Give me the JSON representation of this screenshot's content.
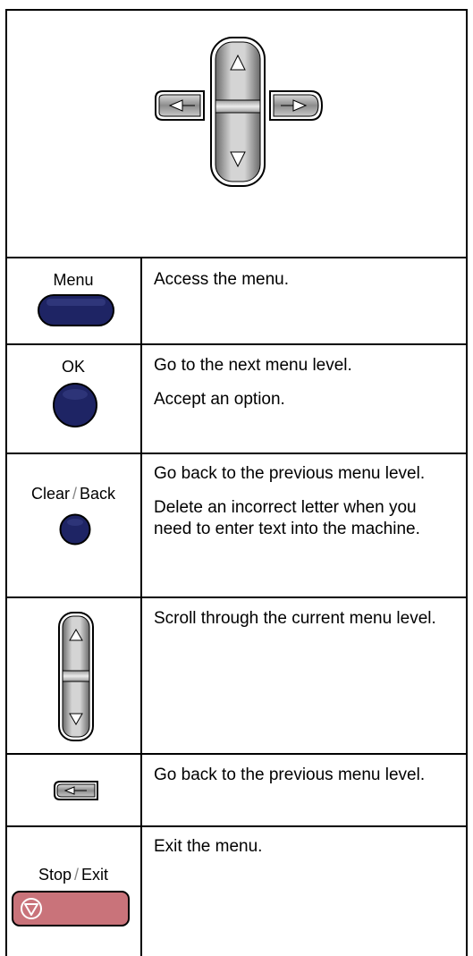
{
  "rows": [
    {
      "button_label": "Menu",
      "description": [
        "Access the menu."
      ]
    },
    {
      "button_label": "OK",
      "description": [
        "Go to the next menu level.",
        "Accept an option."
      ]
    },
    {
      "button_label_left": "Clear",
      "button_label_sep": "/",
      "button_label_right": "Back",
      "description": [
        "Go back to the previous menu level.",
        "Delete an incorrect letter when you need to enter text into the machine."
      ]
    },
    {
      "button_label": "",
      "description": [
        "Scroll through the current menu level."
      ]
    },
    {
      "button_label": "",
      "description": [
        "Go back to the previous menu level."
      ]
    },
    {
      "button_label_left": "Stop",
      "button_label_sep": "/",
      "button_label_right": "Exit",
      "description": [
        "Exit the menu."
      ]
    }
  ],
  "colors": {
    "navy_button": "#1e2464",
    "stop_button": "#c9737a",
    "key_gray": "#9a9a9a"
  },
  "icons": {
    "nav_pad": "navigation-cross-icon",
    "up_down_key": "up-down-key-icon",
    "left_key": "left-arrow-key-icon",
    "stop_symbol": "stop-triangle-icon"
  }
}
